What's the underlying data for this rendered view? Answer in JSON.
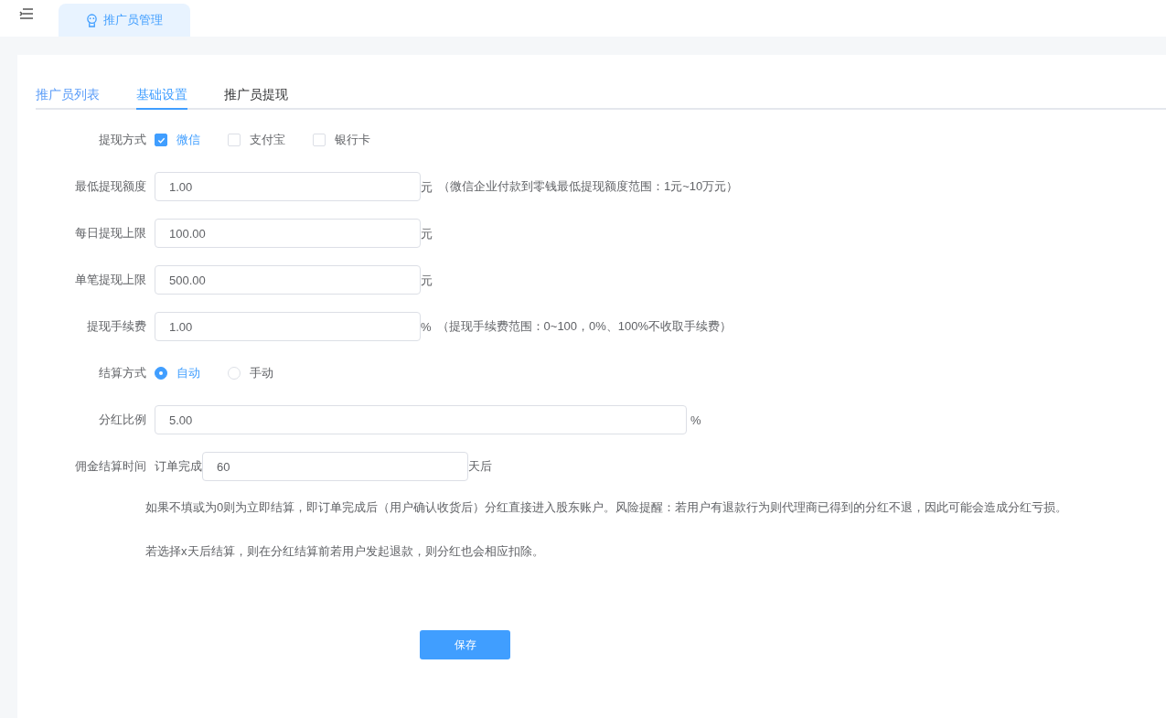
{
  "top_tab": {
    "label": "推广员管理",
    "selected": true
  },
  "tabs": [
    {
      "label": "推广员列表",
      "selected": false
    },
    {
      "label": "基础设置",
      "selected": true
    },
    {
      "label": "推广员提现",
      "selected": false
    }
  ],
  "form": [
    {
      "kind": "checkboxes",
      "label": "提现方式",
      "options": [
        {
          "label": "微信",
          "checked": true
        },
        {
          "label": "支付宝",
          "checked": false
        },
        {
          "label": "银行卡",
          "checked": false
        }
      ]
    },
    {
      "kind": "input",
      "label": "最低提现额度",
      "value": "1.00",
      "suffix": "元",
      "note": "（微信企业付款到零钱最低提现额度范围：1元~10万元）"
    },
    {
      "kind": "input",
      "label": "每日提现上限",
      "value": "100.00",
      "suffix": "元"
    },
    {
      "kind": "input",
      "label": "单笔提现上限",
      "value": "500.00",
      "suffix": "元"
    },
    {
      "kind": "input",
      "label": "提现手续费",
      "value": "1.00",
      "suffix": "%",
      "note": "（提现手续费范围：0~100，0%、100%不收取手续费）"
    },
    {
      "kind": "radios",
      "label": "结算方式",
      "options": [
        {
          "label": "自动",
          "selected": true
        },
        {
          "label": "手动",
          "selected": false
        }
      ]
    },
    {
      "kind": "wide_input",
      "label": "分红比例",
      "value": "5.00",
      "suffix": "%"
    },
    {
      "kind": "prefixed_input",
      "label": "佣金结算时间",
      "prefix": "订单完成",
      "value": "60",
      "suffix": "天后"
    }
  ],
  "help": [
    "如果不填或为0则为立即结算，即订单完成后（用户确认收货后）分红直接进入股东账户。风险提醒：若用户有退款行为则代理商已得到的分红不退，因此可能会造成分红亏损。",
    "若选择x天后结算，则在分红结算前若用户发起退款，则分红也会相应扣除。"
  ],
  "save_button": "保存"
}
